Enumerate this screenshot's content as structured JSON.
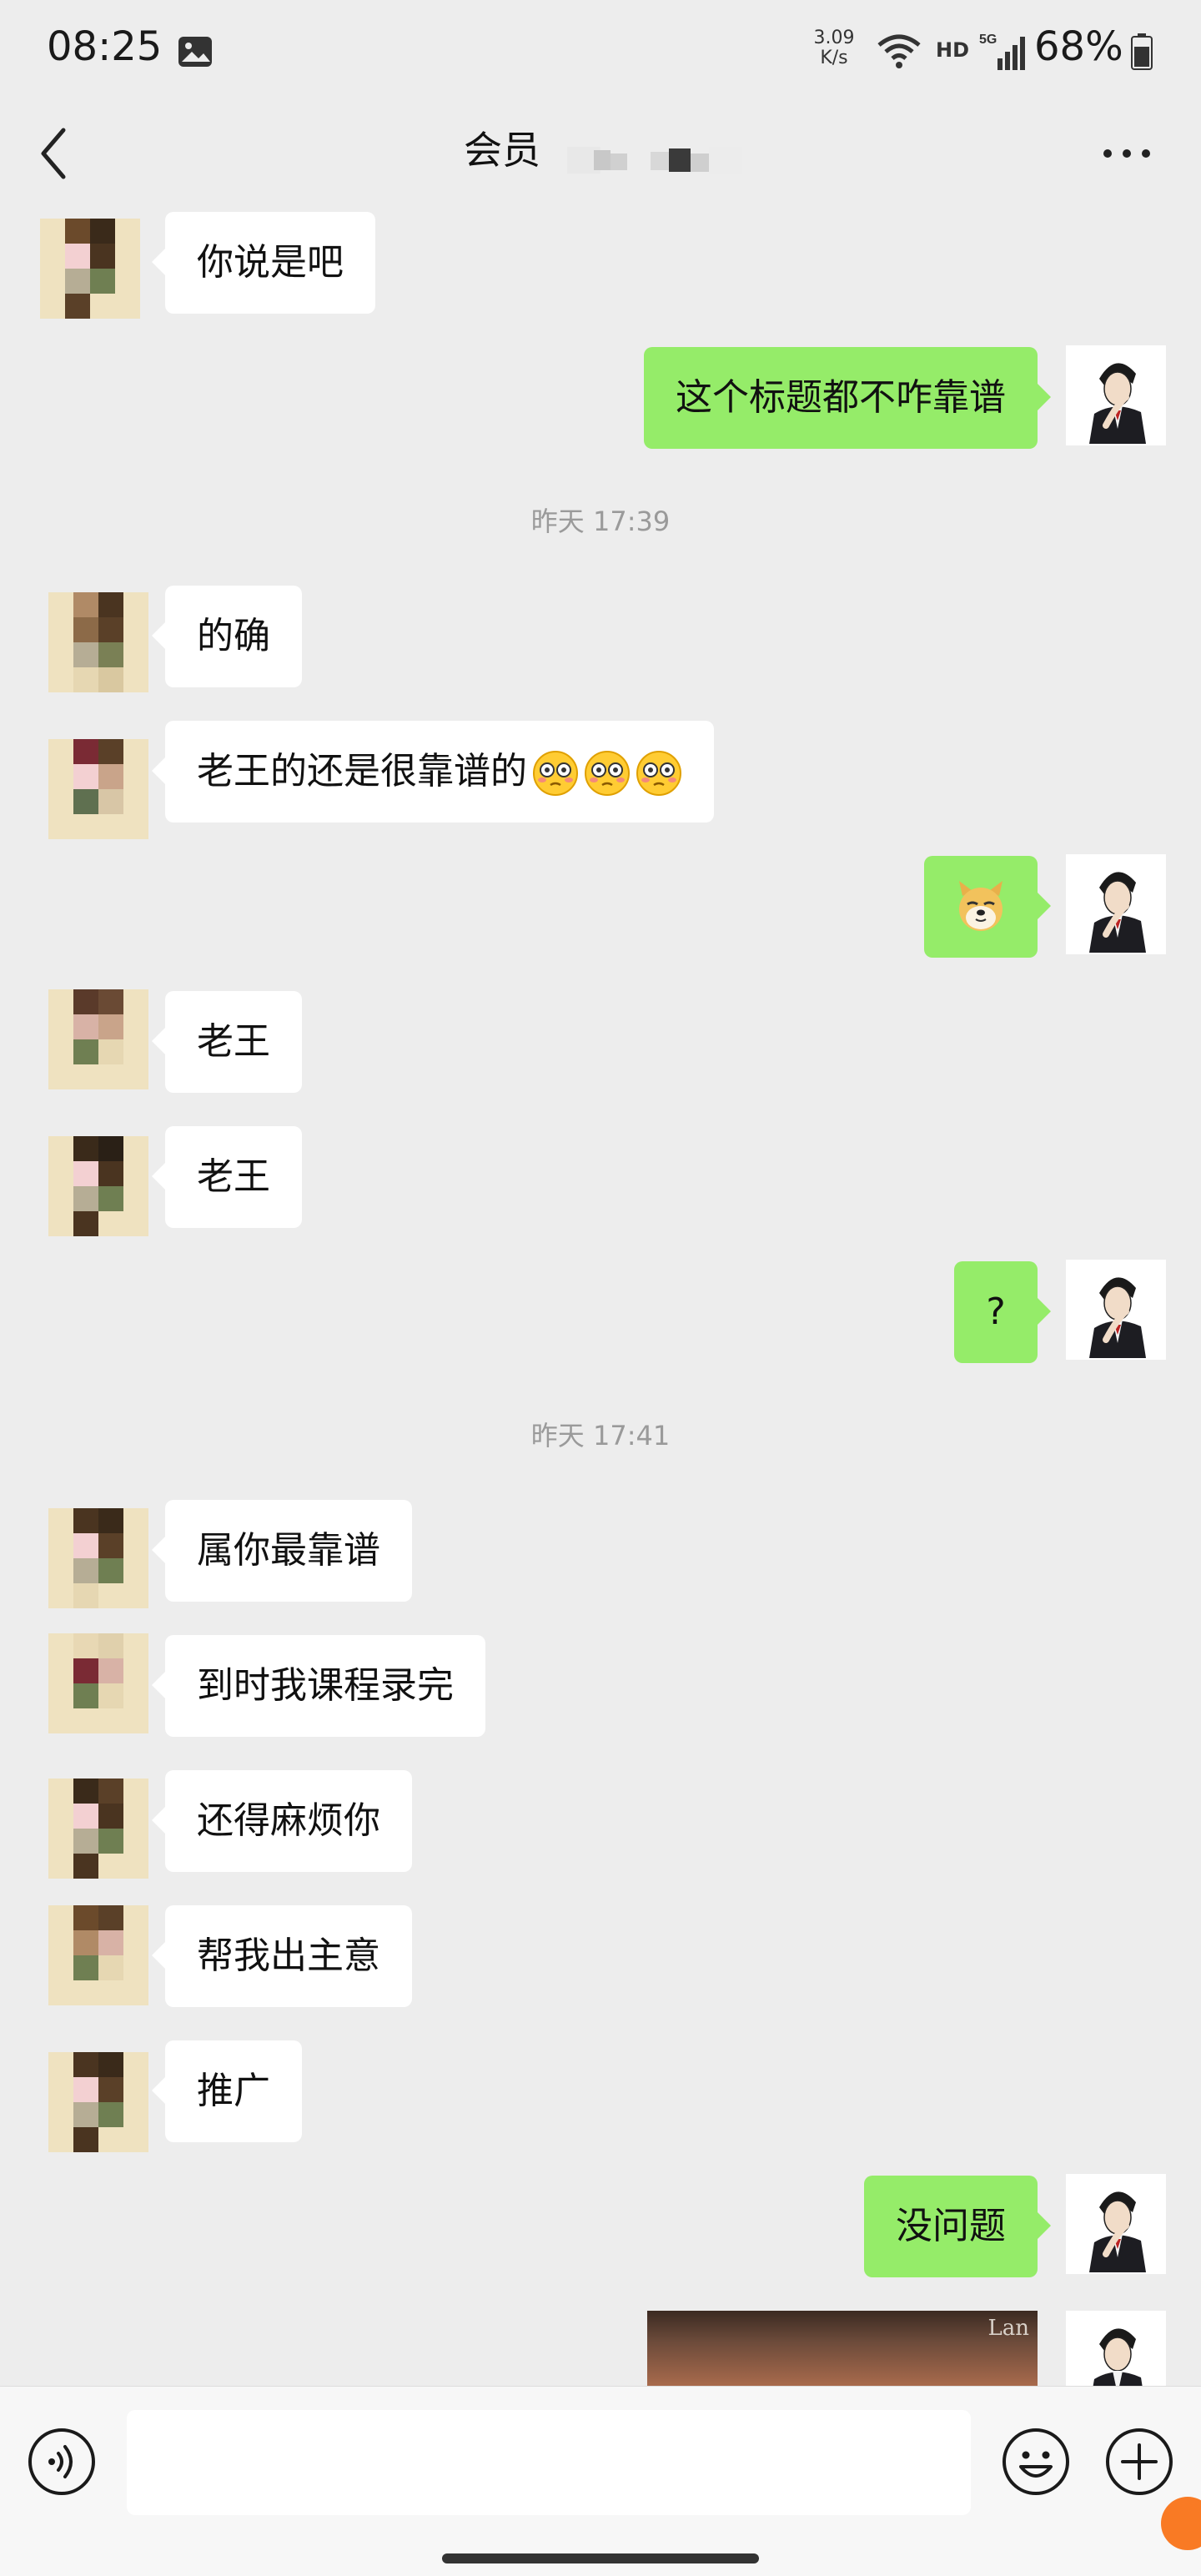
{
  "status_bar": {
    "time": "08:25",
    "net_speed_value": "3.09",
    "net_speed_unit": "K/s",
    "hd_label": "HD",
    "network_type": "5G",
    "battery": "68%"
  },
  "header": {
    "title": "会员"
  },
  "messages": [
    {
      "side": "in",
      "text": "你说是吧"
    },
    {
      "side": "out",
      "text": "这个标题都不咋靠谱"
    },
    {
      "type": "time",
      "text": "昨天 17:39"
    },
    {
      "side": "in",
      "text": "的确"
    },
    {
      "side": "in",
      "text": "老王的还是很靠谱的",
      "emoji": "flushed-face",
      "emoji_count": 3
    },
    {
      "side": "out",
      "text": "",
      "emoji": "doge"
    },
    {
      "side": "in",
      "text": "老王"
    },
    {
      "side": "in",
      "text": "老王"
    },
    {
      "side": "out",
      "text": "?"
    },
    {
      "type": "time",
      "text": "昨天 17:41"
    },
    {
      "side": "in",
      "text": "属你最靠谱"
    },
    {
      "side": "in",
      "text": "到时我课程录完"
    },
    {
      "side": "in",
      "text": "还得麻烦你"
    },
    {
      "side": "in",
      "text": "帮我出主意"
    },
    {
      "side": "in",
      "text": "推广"
    },
    {
      "side": "out",
      "text": "没问题"
    },
    {
      "side": "out",
      "type": "image",
      "caption": "Lan"
    }
  ],
  "input_bar": {
    "placeholder": ""
  },
  "colors": {
    "background": "#ededed",
    "outgoing_bubble": "#95ec69",
    "incoming_bubble": "#ffffff"
  }
}
